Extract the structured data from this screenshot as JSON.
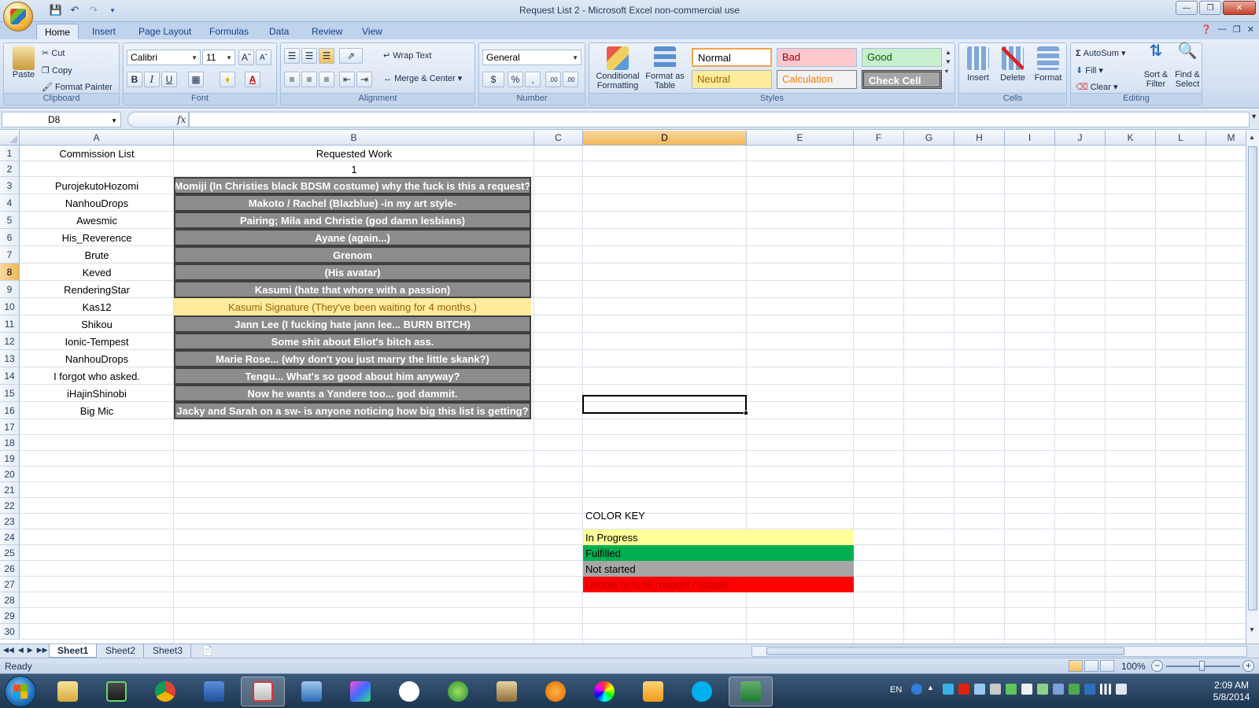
{
  "window": {
    "title": "Request List 2 - Microsoft Excel non-commercial use"
  },
  "ribbon_tabs": [
    "Home",
    "Insert",
    "Page Layout",
    "Formulas",
    "Data",
    "Review",
    "View"
  ],
  "ribbon": {
    "clipboard": {
      "label": "Clipboard",
      "paste": "Paste",
      "cut": "Cut",
      "copy": "Copy",
      "format_painter": "Format Painter"
    },
    "font": {
      "label": "Font",
      "name": "Calibri",
      "size": "11",
      "bold": "B",
      "italic": "I",
      "underline": "U"
    },
    "alignment": {
      "label": "Alignment",
      "wrap_text": "Wrap Text",
      "merge_center": "Merge & Center"
    },
    "number": {
      "label": "Number",
      "format": "General",
      "currency": "$",
      "percent": "%",
      "comma": ",",
      "inc_decimal": ".00",
      "dec_decimal": ".00"
    },
    "styles": {
      "label": "Styles",
      "conditional": "Conditional Formatting",
      "format_table": "Format as Table",
      "cells": [
        {
          "label": "Normal",
          "bg": "#ffffff",
          "fg": "#000000"
        },
        {
          "label": "Bad",
          "bg": "#ffc7ce",
          "fg": "#9c0006"
        },
        {
          "label": "Good",
          "bg": "#c6efce",
          "fg": "#006100"
        },
        {
          "label": "Neutral",
          "bg": "#ffeb9c",
          "fg": "#9c6500"
        },
        {
          "label": "Calculation",
          "bg": "#f2f2f2",
          "fg": "#fa7d00"
        },
        {
          "label": "Check Cell",
          "bg": "#a5a5a5",
          "fg": "#ffffff"
        }
      ]
    },
    "cells": {
      "label": "Cells",
      "insert": "Insert",
      "delete": "Delete",
      "format": "Format"
    },
    "editing": {
      "label": "Editing",
      "autosum": "AutoSum",
      "fill": "Fill",
      "clear": "Clear",
      "sort_filter": "Sort & Filter",
      "find_select": "Find & Select"
    }
  },
  "formula_bar": {
    "name_box": "D8",
    "fx": "fx",
    "formula": ""
  },
  "columns": [
    "A",
    "B",
    "C",
    "D",
    "E",
    "F",
    "G",
    "H",
    "I",
    "J",
    "K",
    "L",
    "M"
  ],
  "selected_column": "D",
  "selected_row": "8",
  "rows": [
    "1",
    "2",
    "3",
    "4",
    "5",
    "6",
    "7",
    "8",
    "9",
    "10",
    "11",
    "12",
    "13",
    "14",
    "15",
    "16",
    "17",
    "18",
    "19",
    "20",
    "21",
    "22",
    "23",
    "24",
    "25",
    "26",
    "27",
    "28",
    "29",
    "30"
  ],
  "header_cells": {
    "a1": "Commission List",
    "b1": "Requested Work",
    "b2": "1"
  },
  "commissions": [
    {
      "name": "PurojekutoHozomi",
      "work": "Momiji (In Christies black BDSM costume) why the fuck is this a request?",
      "status": "not_started"
    },
    {
      "name": "NanhouDrops",
      "work": "Makoto / Rachel (Blazblue) -in my art style-",
      "status": "not_started"
    },
    {
      "name": "Awesmic",
      "work": "Pairing; Mila and Christie (god damn lesbians)",
      "status": "not_started"
    },
    {
      "name": "His_Reverence",
      "work": "Ayane (again...)",
      "status": "not_started"
    },
    {
      "name": "Brute",
      "work": "Grenom",
      "status": "not_started"
    },
    {
      "name": "Keved",
      "work": "(His avatar)",
      "status": "not_started"
    },
    {
      "name": "RenderingStar",
      "work": "Kasumi (hate that whore with a passion)",
      "status": "not_started"
    },
    {
      "name": "Kas12",
      "work": "Kasumi Signature (They've been waiting for 4 months.)",
      "status": "in_progress"
    },
    {
      "name": "Shikou",
      "work": "Jann Lee (I fucking hate jann lee... BURN BITCH)",
      "status": "not_started"
    },
    {
      "name": "Ionic-Tempest",
      "work": "Some shit about Eliot's bitch ass.",
      "status": "not_started"
    },
    {
      "name": "NanhouDrops",
      "work": "Marie Rose... (why don't you just marry the little skank?)",
      "status": "not_started"
    },
    {
      "name": "I forgot who asked.",
      "work": "Tengu... What's so good about him anyway?",
      "status": "not_started"
    },
    {
      "name": "iHajinShinobi",
      "work": "Now he wants a Yandere too... god dammit.",
      "status": "not_started"
    },
    {
      "name": "Big Mic",
      "work": "Jacky and Sarah on a sw- is anyone noticing how big this list is getting?",
      "status": "not_started"
    }
  ],
  "color_key": {
    "title": "COLOR KEY",
    "items": [
      {
        "label": "In Progress",
        "bg": "#ffff99",
        "fg": "#000000"
      },
      {
        "label": "Fulfilled",
        "bg": "#00b050",
        "fg": "#000000"
      },
      {
        "label": "Not started",
        "bg": "#a6a6a6",
        "fg": "#000000"
      },
      {
        "label": "Unable to fulfill request / Issues",
        "bg": "#ff0000",
        "fg": "#c00000"
      }
    ]
  },
  "sheets": [
    "Sheet1",
    "Sheet2",
    "Sheet3"
  ],
  "active_sheet": "Sheet1",
  "status": {
    "ready": "Ready",
    "zoom": "100%"
  },
  "taskbar": {
    "lang": "EN",
    "time": "2:09 AM",
    "date": "5/8/2014"
  }
}
